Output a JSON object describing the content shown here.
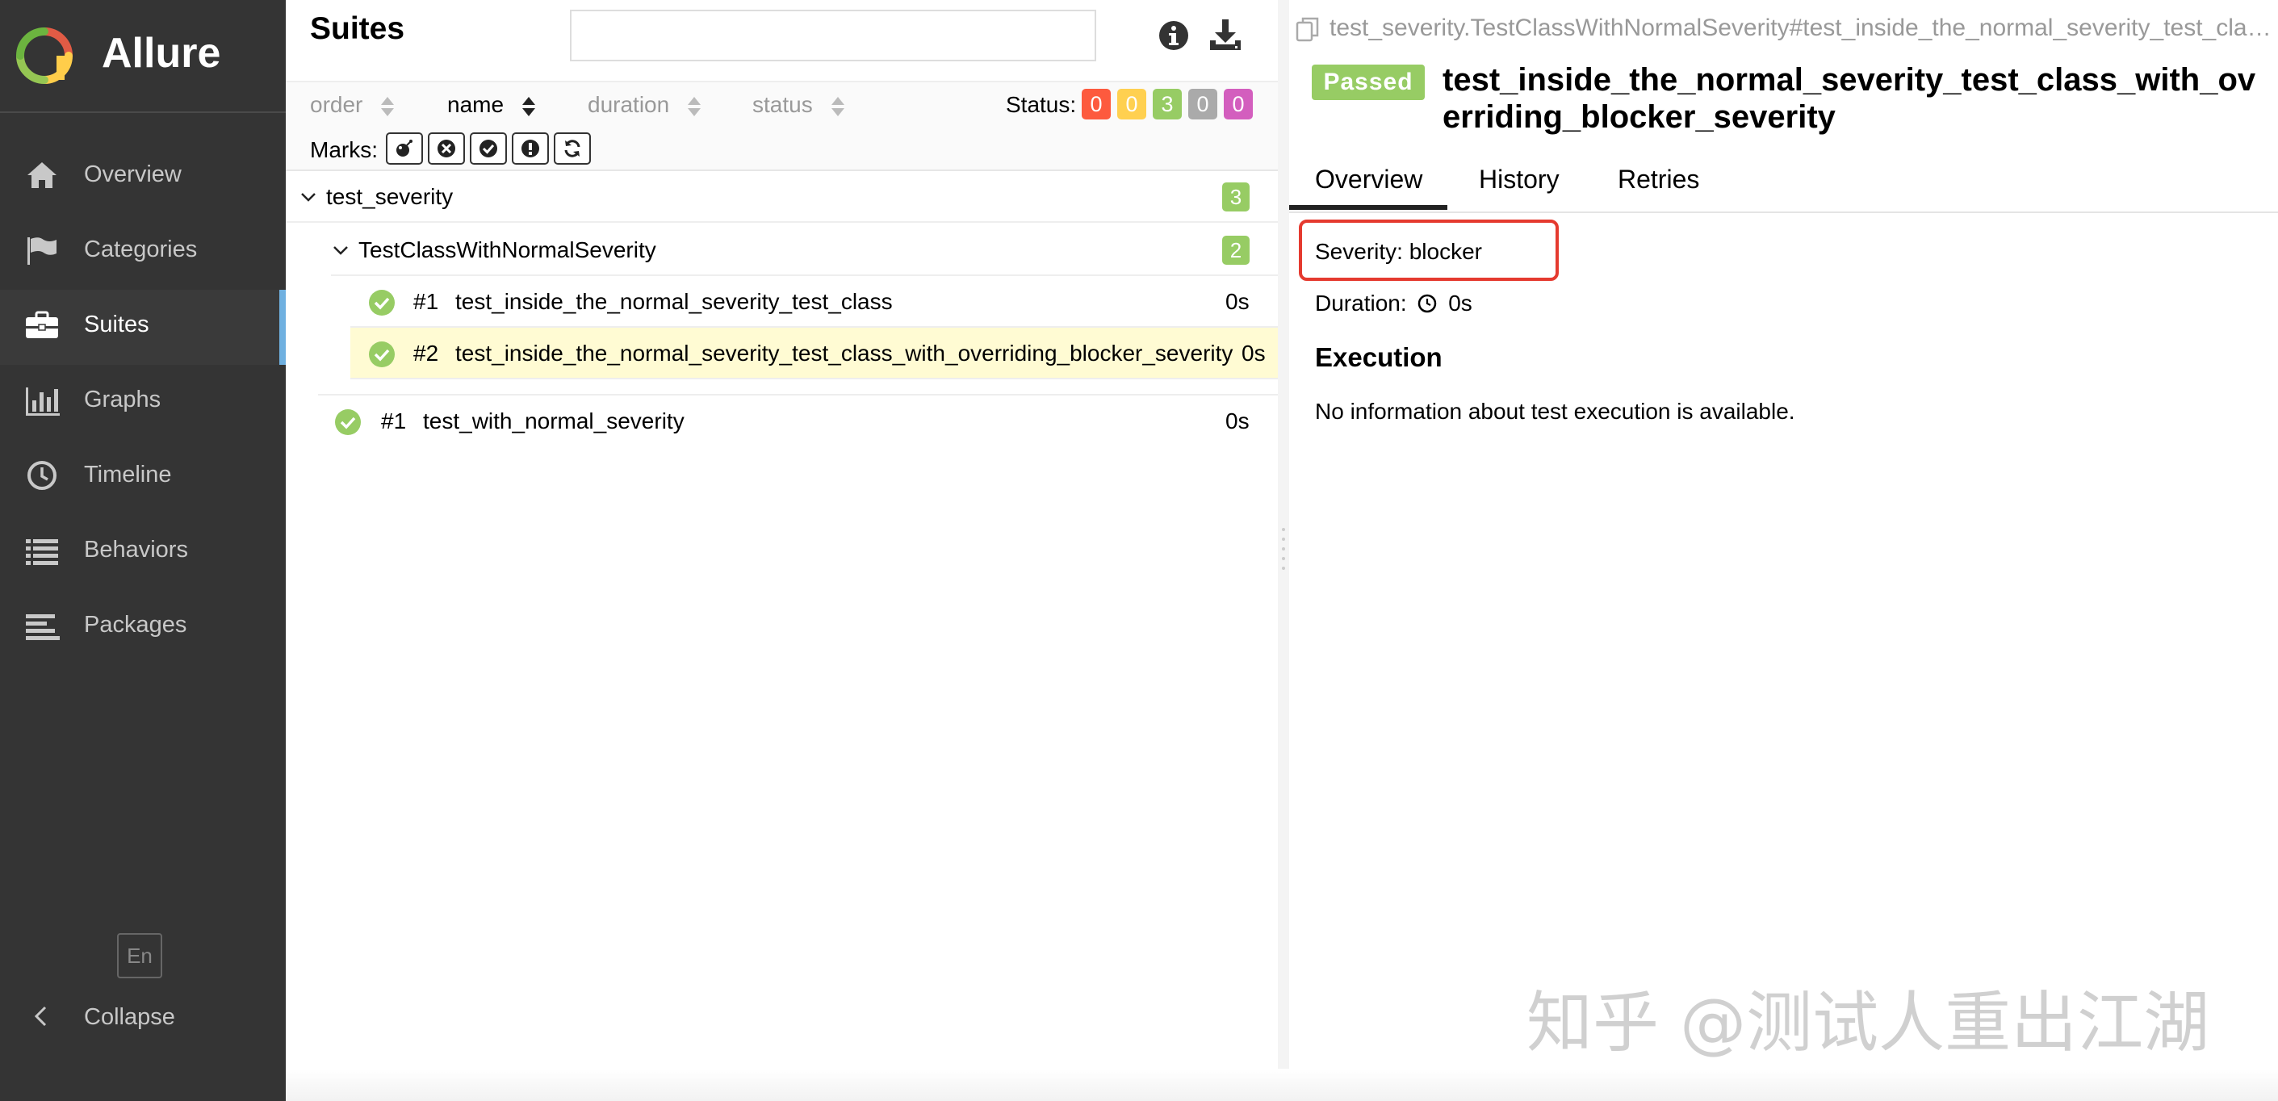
{
  "app": {
    "name": "Allure"
  },
  "sidebar": {
    "items": [
      {
        "label": "Overview",
        "icon": "home-icon"
      },
      {
        "label": "Categories",
        "icon": "flag-icon"
      },
      {
        "label": "Suites",
        "icon": "briefcase-icon",
        "active": true
      },
      {
        "label": "Graphs",
        "icon": "bar-chart-icon"
      },
      {
        "label": "Timeline",
        "icon": "clock-icon"
      },
      {
        "label": "Behaviors",
        "icon": "list-icon"
      },
      {
        "label": "Packages",
        "icon": "align-left-icon"
      }
    ],
    "language": "En",
    "collapse_label": "Collapse"
  },
  "suites": {
    "title": "Suites",
    "search": {
      "value": "",
      "placeholder": ""
    },
    "sort": {
      "order": "order",
      "name": "name",
      "duration": "duration",
      "status": "status",
      "active": "name"
    },
    "status_label": "Status:",
    "status_counts": [
      {
        "name": "failed",
        "count": "0",
        "color": "#fd5a3e"
      },
      {
        "name": "broken",
        "count": "0",
        "color": "#ffd050"
      },
      {
        "name": "passed",
        "count": "3",
        "color": "#97cc64"
      },
      {
        "name": "skipped",
        "count": "0",
        "color": "#aaaaaa"
      },
      {
        "name": "unknown",
        "count": "0",
        "color": "#d35ebe"
      }
    ],
    "marks_label": "Marks:",
    "marks": [
      "flaky-bomb-icon",
      "new-failed-icon",
      "new-passed-icon",
      "new-broken-icon",
      "retries-icon"
    ],
    "tree": {
      "suite": {
        "name": "test_severity",
        "count": "3"
      },
      "class": {
        "name": "TestClassWithNormalSeverity",
        "count": "2"
      },
      "tests": [
        {
          "num": "#1",
          "name": "test_inside_the_normal_severity_test_class",
          "duration": "0s"
        },
        {
          "num": "#2",
          "name": "test_inside_the_normal_severity_test_class_with_overriding_blocker_severity",
          "duration": "0s"
        }
      ],
      "root_test": {
        "num": "#1",
        "name": "test_with_normal_severity",
        "duration": "0s"
      }
    }
  },
  "testcase": {
    "full_name": "test_severity.TestClassWithNormalSeverity#test_inside_the_normal_severity_test_class_with_overriding_blocker_severity",
    "status": "Passed",
    "title": "test_inside_the_normal_severity_test_class_with_overriding_blocker_severity",
    "tabs": [
      "Overview",
      "History",
      "Retries"
    ],
    "active_tab": "Overview",
    "severity": "Severity: blocker",
    "duration_label": "Duration:",
    "duration_value": "0s",
    "execution_title": "Execution",
    "execution_text": "No information about test execution is available."
  },
  "watermark": "知乎 @测试人重出江湖"
}
